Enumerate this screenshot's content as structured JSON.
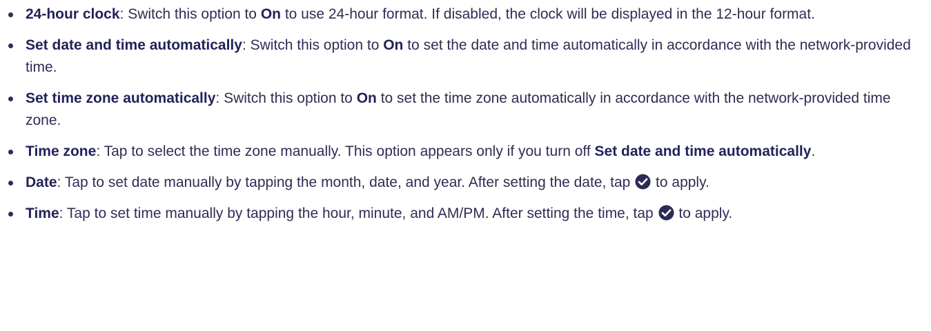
{
  "items": [
    {
      "term": "24-hour clock",
      "sep1": ": Switch this option to ",
      "on": "On",
      "text": " to use 24-hour format. If disabled, the clock will be displayed in the 12-hour format."
    },
    {
      "term": "Set date and time automatically",
      "sep1": ": Switch this option to ",
      "on": "On",
      "text": " to set the date and time automatically in accordance with the network-provided time."
    },
    {
      "term": "Set time zone automatically",
      "sep1": ": Switch this option to ",
      "on": "On",
      "text": " to set the time zone automatically in accordance with the network-provided time zone."
    },
    {
      "term": "Time zone",
      "text": ": Tap to select the time zone manually. This option appears only if you turn off ",
      "ref": "Set date and time automatically",
      "end": "."
    },
    {
      "term": "Date",
      "text": ": Tap to set date manually by tapping the month, date, and year. After setting the date, tap ",
      "icon": "check-circle-icon",
      "end": " to apply."
    },
    {
      "term": "Time",
      "text": ": Tap to set time manually by tapping the hour, minute, and AM/PM. After setting the time, tap ",
      "icon": "check-circle-icon",
      "end": " to apply."
    }
  ],
  "colors": {
    "text": "#2d2d54",
    "check_fill": "#2b2b55"
  }
}
